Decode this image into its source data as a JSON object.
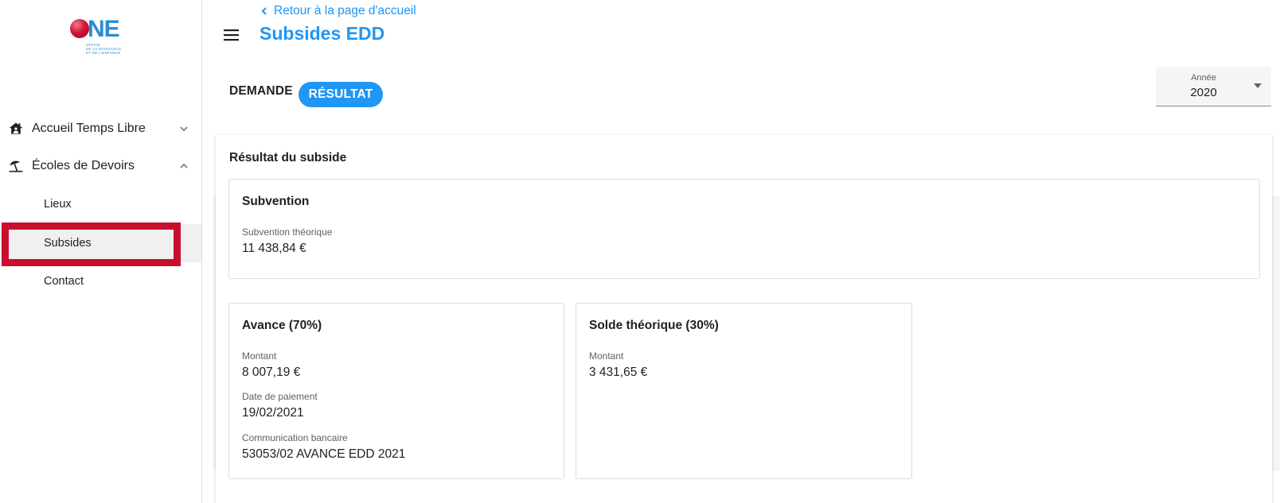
{
  "brand": {
    "logo_text": "ONE",
    "logo_sub": [
      "OFFICE",
      "DE LA NAISSANCE",
      "ET DE L'ENFANCE"
    ]
  },
  "sidebar": {
    "items": [
      {
        "label": "Accueil Temps Libre",
        "icon": "home-person-icon",
        "expanded": false
      },
      {
        "label": "Écoles de Devoirs",
        "icon": "umbrella-beach-icon",
        "expanded": true
      }
    ],
    "sub_items": [
      {
        "label": "Lieux",
        "active": false
      },
      {
        "label": "Subsides",
        "active": true
      },
      {
        "label": "Contact",
        "active": false
      }
    ]
  },
  "header": {
    "back_label": "Retour à la page d'accueil",
    "title": "Subsides EDD"
  },
  "tabs": [
    {
      "label": "DEMANDE",
      "active": false
    },
    {
      "label": "RÉSULTAT",
      "active": true
    }
  ],
  "year_select": {
    "label": "Année",
    "value": "2020"
  },
  "result": {
    "heading": "Résultat du subside",
    "subvention": {
      "title": "Subvention",
      "label": "Subvention théorique",
      "value": "11 438,84 €"
    },
    "avance": {
      "title": "Avance (70%)",
      "fields": [
        {
          "label": "Montant",
          "value": "8 007,19 €"
        },
        {
          "label": "Date de paiement",
          "value": "19/02/2021"
        },
        {
          "label": "Communication bancaire",
          "value": "53053/02 AVANCE EDD 2021"
        }
      ]
    },
    "solde": {
      "title": "Solde théorique (30%)",
      "fields": [
        {
          "label": "Montant",
          "value": "3 431,65 €"
        }
      ]
    }
  },
  "colors": {
    "primary": "#2196f3",
    "brand_red": "#c8102e",
    "brand_blue": "#2a8dd4"
  }
}
